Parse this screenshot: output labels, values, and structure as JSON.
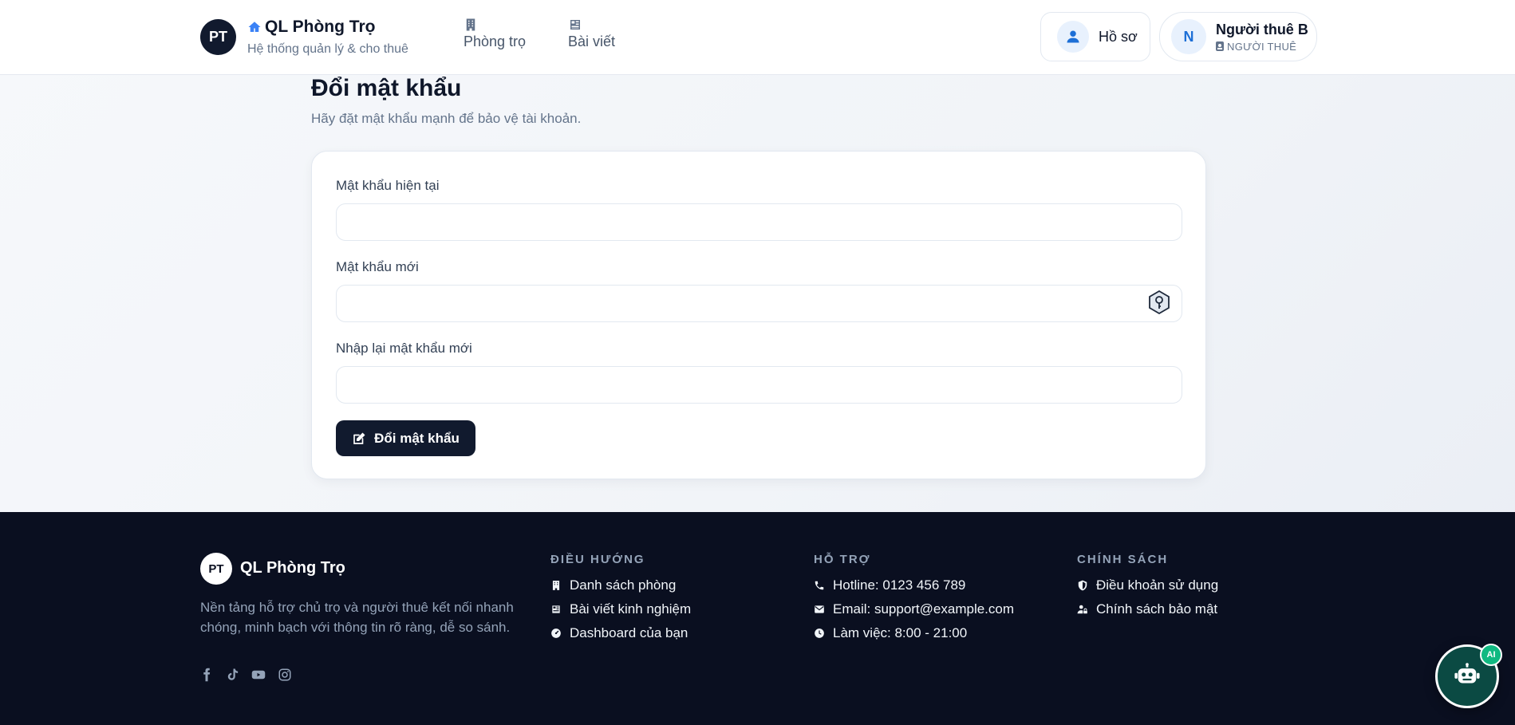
{
  "header": {
    "logo_initials": "PT",
    "brand_title": "QL Phòng Trọ",
    "brand_subtitle": "Hệ thống quản lý & cho thuê",
    "nav": [
      {
        "label": "Phòng trọ",
        "icon": "building-icon"
      },
      {
        "label": "Bài viết",
        "icon": "newspaper-icon"
      }
    ],
    "profile_label": "Hồ sơ",
    "user": {
      "initial": "N",
      "name": "Người thuê B",
      "role": "NGƯỜI THUÊ"
    }
  },
  "main": {
    "title": "Đổi mật khẩu",
    "subtitle": "Hãy đặt mật khẩu mạnh để bảo vệ tài khoản.",
    "fields": [
      {
        "label": "Mật khẩu hiện tại",
        "value": ""
      },
      {
        "label": "Mật khẩu mới",
        "value": ""
      },
      {
        "label": "Nhập lại mật khẩu mới",
        "value": ""
      }
    ],
    "submit_label": "Đổi mật khẩu"
  },
  "footer": {
    "logo_initials": "PT",
    "brand": "QL Phòng Trọ",
    "description": "Nền tảng hỗ trợ chủ trọ và người thuê kết nối nhanh chóng, minh bạch với thông tin rõ ràng, dễ so sánh.",
    "columns": [
      {
        "heading": "ĐIỀU HƯỚNG",
        "items": [
          {
            "label": "Danh sách phòng",
            "icon": "building-icon"
          },
          {
            "label": "Bài viết kinh nghiệm",
            "icon": "newspaper-icon"
          },
          {
            "label": "Dashboard của bạn",
            "icon": "gauge-icon"
          }
        ]
      },
      {
        "heading": "HỖ TRỢ",
        "items": [
          {
            "label": "Hotline: 0123 456 789",
            "icon": "phone-icon"
          },
          {
            "label": "Email: support@example.com",
            "icon": "envelope-icon"
          },
          {
            "label": "Làm việc: 8:00 - 21:00",
            "icon": "clock-icon"
          }
        ]
      },
      {
        "heading": "CHÍNH SÁCH",
        "items": [
          {
            "label": "Điều khoản sử dụng",
            "icon": "shield-icon"
          },
          {
            "label": "Chính sách bảo mật",
            "icon": "user-lock-icon"
          }
        ]
      }
    ]
  },
  "ai_badge": "AI",
  "colors": {
    "primary": "#111a2e",
    "accent": "#1d6fd6",
    "footer_bg": "#0a0f20",
    "ai_green": "#10b981"
  }
}
